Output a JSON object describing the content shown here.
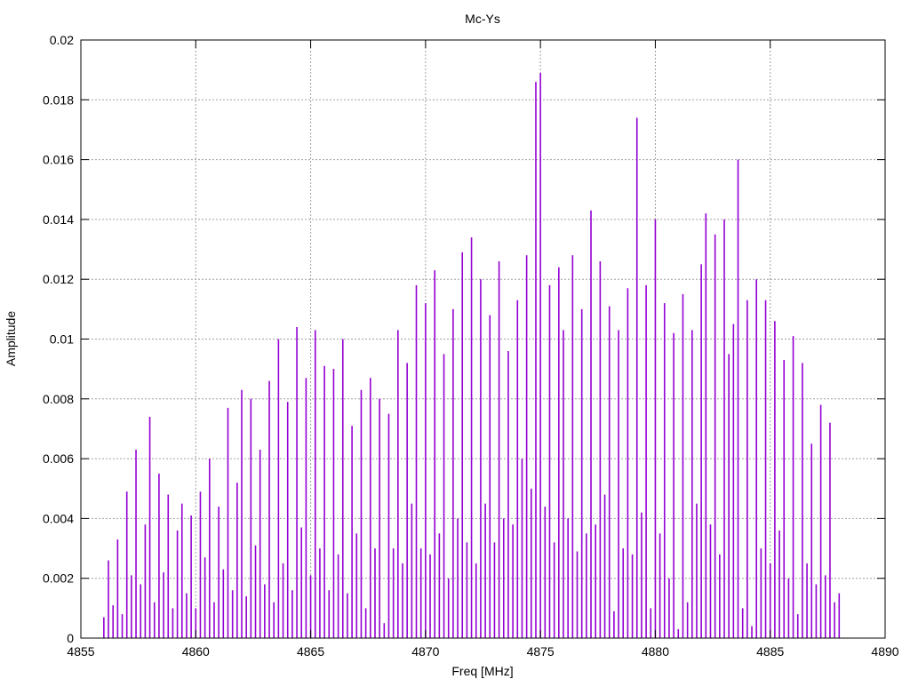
{
  "chart_data": {
    "type": "impulse",
    "title": "Mc-Ys",
    "xlabel": "Freq [MHz]",
    "ylabel": "Amplitude",
    "xlim": [
      4855,
      4890
    ],
    "ylim": [
      0,
      0.02
    ],
    "grid": true,
    "x_ticks": [
      "4855",
      "4860",
      "4865",
      "4870",
      "4875",
      "4880",
      "4885",
      "4890"
    ],
    "x_tick_values": [
      4855,
      4860,
      4865,
      4870,
      4875,
      4880,
      4885,
      4890
    ],
    "y_ticks": [
      "0",
      "0.002",
      "0.004",
      "0.006",
      "0.008",
      "0.01",
      "0.012",
      "0.014",
      "0.016",
      "0.018",
      "0.02"
    ],
    "y_tick_values": [
      0,
      0.002,
      0.004,
      0.006,
      0.008,
      0.01,
      0.012,
      0.014,
      0.016,
      0.018,
      0.02
    ],
    "series": [
      {
        "name": "Mc-Ys",
        "color": "#9400d3",
        "x_start": 4856.0,
        "x_step": 0.2,
        "values": [
          0.0007,
          0.0026,
          0.0011,
          0.0033,
          0.0008,
          0.0049,
          0.0021,
          0.0063,
          0.0018,
          0.0038,
          0.0074,
          0.0012,
          0.0055,
          0.0022,
          0.0048,
          0.001,
          0.0036,
          0.0045,
          0.0015,
          0.0041,
          0.001,
          0.0049,
          0.0027,
          0.006,
          0.0012,
          0.0044,
          0.0023,
          0.0077,
          0.0016,
          0.0052,
          0.0083,
          0.0014,
          0.008,
          0.0031,
          0.0063,
          0.0018,
          0.0086,
          0.0012,
          0.01,
          0.0025,
          0.0079,
          0.0016,
          0.0104,
          0.0037,
          0.0087,
          0.0021,
          0.0103,
          0.003,
          0.0091,
          0.0016,
          0.009,
          0.0028,
          0.01,
          0.0015,
          0.0071,
          0.0035,
          0.0083,
          0.001,
          0.0087,
          0.003,
          0.008,
          0.0005,
          0.0075,
          0.003,
          0.0103,
          0.0025,
          0.0092,
          0.0045,
          0.0118,
          0.003,
          0.0112,
          0.0028,
          0.0123,
          0.0035,
          0.0095,
          0.002,
          0.011,
          0.004,
          0.0129,
          0.0032,
          0.0134,
          0.0025,
          0.012,
          0.0045,
          0.0108,
          0.0032,
          0.0126,
          0.004,
          0.0096,
          0.0038,
          0.0113,
          0.006,
          0.0128,
          0.005,
          0.0186,
          0.0189,
          0.0044,
          0.0118,
          0.0032,
          0.0124,
          0.0103,
          0.004,
          0.0128,
          0.0029,
          0.011,
          0.0035,
          0.0143,
          0.0038,
          0.0126,
          0.0048,
          0.0111,
          0.0009,
          0.0103,
          0.003,
          0.0117,
          0.0028,
          0.0174,
          0.0042,
          0.0118,
          0.001,
          0.014,
          0.0035,
          0.0112,
          0.002,
          0.0102,
          0.0003,
          0.0115,
          0.0012,
          0.0103,
          0.0045,
          0.0125,
          0.0142,
          0.0038,
          0.0135,
          0.0028,
          0.014,
          0.0095,
          0.0105,
          0.016,
          0.001,
          0.0113,
          0.0004,
          0.012,
          0.003,
          0.0113,
          0.0025,
          0.0106,
          0.0036,
          0.0093,
          0.002,
          0.0101,
          0.0008,
          0.0092,
          0.0025,
          0.0065,
          0.0018,
          0.0078,
          0.0021,
          0.0072,
          0.0012,
          0.0015
        ]
      }
    ]
  }
}
